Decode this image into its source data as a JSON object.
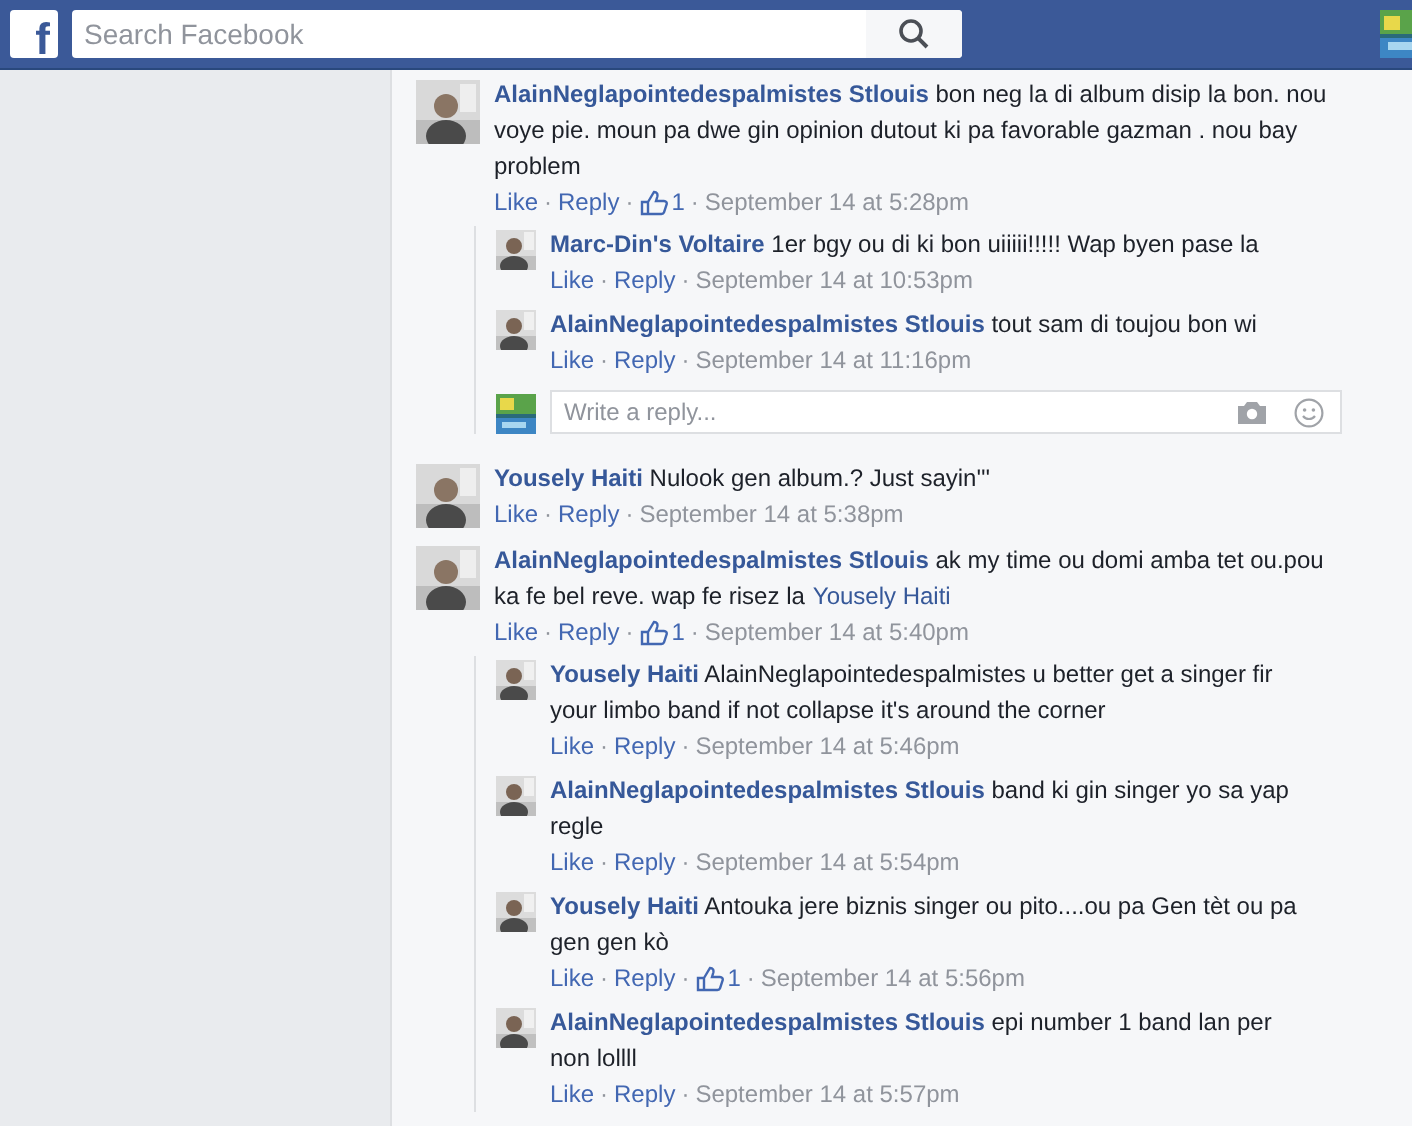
{
  "header": {
    "logo": "f",
    "search": {
      "placeholder": "Search Facebook"
    }
  },
  "separator": "·",
  "comments": [
    {
      "author": "AlainNeglapointedespalmistes Stlouis",
      "text": "bon neg la di album disip la bon. nou voye pie. moun pa dwe gin opinion dutout ki pa favorable gazman . nou bay problem",
      "like": "Like",
      "reply": "Reply",
      "likes": "1",
      "time": "September 14 at 5:28pm",
      "replies": [
        {
          "author": "Marc-Din's Voltaire",
          "text": "1er bgy ou di ki bon uiiiii!!!!! Wap byen pase la",
          "like": "Like",
          "reply": "Reply",
          "time": "September 14 at 10:53pm"
        },
        {
          "author": "AlainNeglapointedespalmistes Stlouis",
          "text": "tout sam di toujou bon wi",
          "like": "Like",
          "reply": "Reply",
          "time": "September 14 at 11:16pm"
        }
      ],
      "reply_box": {
        "placeholder": "Write a reply..."
      }
    },
    {
      "author": "Yousely Haiti",
      "text": "Nulook gen album.? Just sayin'''",
      "like": "Like",
      "reply": "Reply",
      "time": "September 14 at 5:38pm"
    },
    {
      "author": "AlainNeglapointedespalmistes Stlouis",
      "text": "ak my time ou domi amba tet ou.pou ka fe bel reve. wap fe risez la",
      "mention": "Yousely Haiti",
      "like": "Like",
      "reply": "Reply",
      "likes": "1",
      "time": "September 14 at 5:40pm",
      "replies": [
        {
          "author": "Yousely Haiti",
          "text": "AlainNeglapointedespalmistes u better get a singer fir your limbo band if not collapse it's around the corner",
          "like": "Like",
          "reply": "Reply",
          "time": "September 14 at 5:46pm"
        },
        {
          "author": "AlainNeglapointedespalmistes Stlouis",
          "text": "band ki gin singer yo sa yap regle",
          "like": "Like",
          "reply": "Reply",
          "time": "September 14 at 5:54pm"
        },
        {
          "author": "Yousely Haiti",
          "text": "Antouka jere biznis singer ou pito....ou pa Gen tèt ou pa gen gen kò",
          "like": "Like",
          "reply": "Reply",
          "likes": "1",
          "time": "September 14 at 5:56pm"
        },
        {
          "author": "AlainNeglapointedespalmistes Stlouis",
          "text": "epi number 1 band lan per non lollll",
          "like": "Like",
          "reply": "Reply",
          "time": "September 14 at 5:57pm"
        }
      ]
    }
  ]
}
